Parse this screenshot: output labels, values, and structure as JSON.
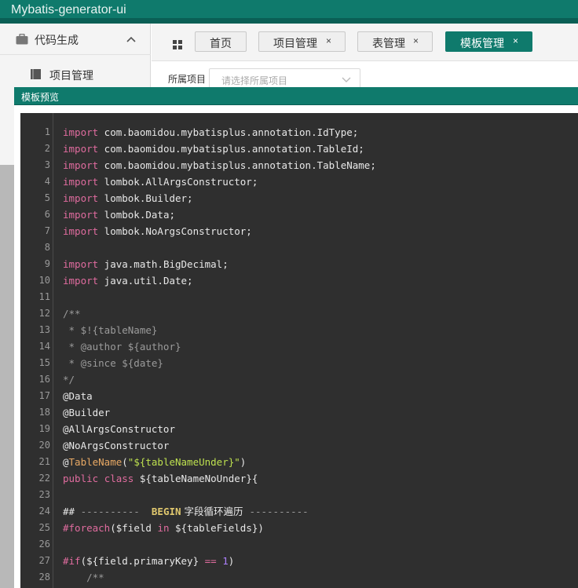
{
  "app": {
    "title": "Mybatis-generator-ui"
  },
  "sidebar": {
    "group_label": "代码生成",
    "items": [
      {
        "label": "项目管理"
      }
    ]
  },
  "tabs": [
    {
      "label": "首页",
      "closable": false,
      "active": false
    },
    {
      "label": "项目管理",
      "closable": true,
      "active": false
    },
    {
      "label": "表管理",
      "closable": true,
      "active": false
    },
    {
      "label": "模板管理",
      "closable": true,
      "active": true
    }
  ],
  "close_glyph": "×",
  "filter": {
    "label": "所属项目",
    "placeholder": "请选择所属项目"
  },
  "modal": {
    "title": "模板预览"
  },
  "colors": {
    "accent": "#0f7a6c",
    "editor_bg": "#2f2f2f"
  },
  "code": {
    "line_numbers": [
      "1",
      "2",
      "3",
      "4",
      "5",
      "6",
      "7",
      "8",
      "9",
      "10",
      "11",
      "12",
      "13",
      "14",
      "15",
      "16",
      "17",
      "18",
      "19",
      "20",
      "21",
      "22",
      "23",
      "24",
      "25",
      "26",
      "27",
      "28"
    ],
    "lines": [
      [
        {
          "t": "kw",
          "v": "import"
        },
        {
          "t": "tx",
          "v": " com.baomidou.mybatisplus.annotation.IdType;"
        }
      ],
      [
        {
          "t": "kw",
          "v": "import"
        },
        {
          "t": "tx",
          "v": " com.baomidou.mybatisplus.annotation.TableId;"
        }
      ],
      [
        {
          "t": "kw",
          "v": "import"
        },
        {
          "t": "tx",
          "v": " com.baomidou.mybatisplus.annotation.TableName;"
        }
      ],
      [
        {
          "t": "kw",
          "v": "import"
        },
        {
          "t": "tx",
          "v": " lombok.AllArgsConstructor;"
        }
      ],
      [
        {
          "t": "kw",
          "v": "import"
        },
        {
          "t": "tx",
          "v": " lombok.Builder;"
        }
      ],
      [
        {
          "t": "kw",
          "v": "import"
        },
        {
          "t": "tx",
          "v": " lombok.Data;"
        }
      ],
      [
        {
          "t": "kw",
          "v": "import"
        },
        {
          "t": "tx",
          "v": " lombok.NoArgsConstructor;"
        }
      ],
      [],
      [
        {
          "t": "kw",
          "v": "import"
        },
        {
          "t": "tx",
          "v": " java.math.BigDecimal;"
        }
      ],
      [
        {
          "t": "kw",
          "v": "import"
        },
        {
          "t": "tx",
          "v": " java.util.Date;"
        }
      ],
      [],
      [
        {
          "t": "cm",
          "v": "/**"
        }
      ],
      [
        {
          "t": "cm",
          "v": " * $!{tableName}"
        }
      ],
      [
        {
          "t": "cm",
          "v": " * @author ${author}"
        }
      ],
      [
        {
          "t": "cm",
          "v": " * @since ${date}"
        }
      ],
      [
        {
          "t": "cm",
          "v": "*/"
        }
      ],
      [
        {
          "t": "an",
          "v": "@Data"
        }
      ],
      [
        {
          "t": "an",
          "v": "@Builder"
        }
      ],
      [
        {
          "t": "an",
          "v": "@AllArgsConstructor"
        }
      ],
      [
        {
          "t": "an",
          "v": "@NoArgsConstructor"
        }
      ],
      [
        {
          "t": "an",
          "v": "@"
        },
        {
          "t": "nm",
          "v": "TableName"
        },
        {
          "t": "tx",
          "v": "("
        },
        {
          "t": "st",
          "v": "\"${tableNameUnder}\""
        },
        {
          "t": "tx",
          "v": ")"
        }
      ],
      [
        {
          "t": "kw",
          "v": "public"
        },
        {
          "t": "tx",
          "v": " "
        },
        {
          "t": "kw",
          "v": "class"
        },
        {
          "t": "tx",
          "v": " ${tableNameNoUnder}{"
        }
      ],
      [],
      [
        {
          "t": "tx",
          "v": "## "
        },
        {
          "t": "cm",
          "v": "----------  "
        },
        {
          "t": "gold",
          "v": "BEGIN"
        },
        {
          "t": "cn",
          "v": " 字段循环遍历  "
        },
        {
          "t": "cm",
          "v": "----------"
        }
      ],
      [
        {
          "t": "dir",
          "v": "#foreach"
        },
        {
          "t": "tx",
          "v": "($field "
        },
        {
          "t": "kw",
          "v": "in"
        },
        {
          "t": "tx",
          "v": " ${tableFields})"
        }
      ],
      [],
      [
        {
          "t": "dir",
          "v": "#if"
        },
        {
          "t": "tx",
          "v": "(${field.primaryKey} "
        },
        {
          "t": "op",
          "v": "=="
        },
        {
          "t": "tx",
          "v": " "
        },
        {
          "t": "num",
          "v": "1"
        },
        {
          "t": "tx",
          "v": ")"
        }
      ],
      [
        {
          "t": "cm",
          "v": "    /**"
        }
      ]
    ]
  }
}
